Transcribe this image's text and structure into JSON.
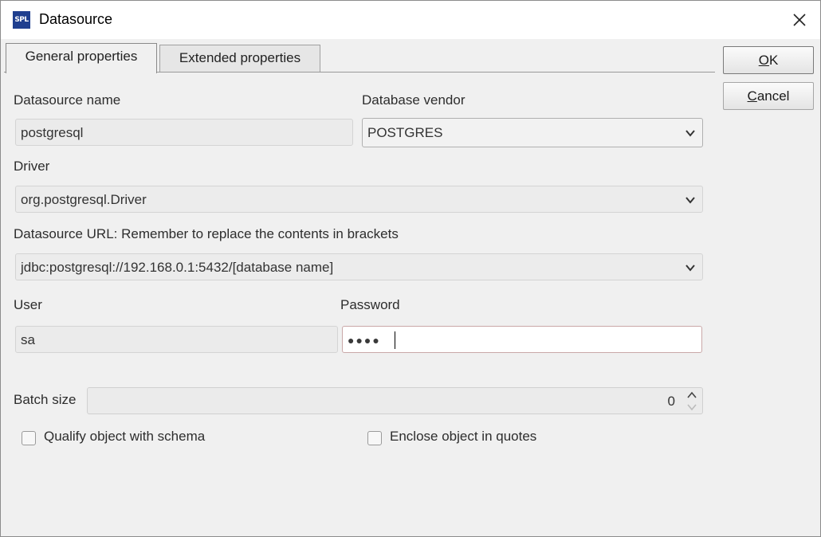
{
  "window": {
    "title": "Datasource",
    "app_icon_text": "SPL"
  },
  "tabs": [
    {
      "label": "General properties",
      "active": true
    },
    {
      "label": "Extended properties",
      "active": false
    }
  ],
  "buttons": {
    "ok": {
      "mnemonic": "O",
      "rest": "K"
    },
    "cancel": {
      "mnemonic": "C",
      "rest": "ancel"
    }
  },
  "form": {
    "datasource_name": {
      "label": "Datasource name",
      "value": "postgresql"
    },
    "database_vendor": {
      "label": "Database vendor",
      "value": "POSTGRES"
    },
    "driver": {
      "label": "Driver",
      "value": "org.postgresql.Driver"
    },
    "datasource_url": {
      "label": "Datasource URL: Remember to replace the contents in brackets",
      "value": "jdbc:postgresql://192.168.0.1:5432/[database name]"
    },
    "user": {
      "label": "User",
      "value": "sa"
    },
    "password": {
      "label": "Password",
      "masked_value": "●●●●"
    },
    "batch_size": {
      "label": "Batch size",
      "value": "0"
    },
    "qualify_schema": {
      "label": "Qualify object with schema",
      "checked": false
    },
    "enclose_quotes": {
      "label": "Enclose object in quotes",
      "checked": false
    }
  },
  "icons": {
    "app": "spl-app-icon",
    "close": "close-icon",
    "dropdown": "chevron-down-icon",
    "spin_up": "chevron-up-icon",
    "spin_down": "chevron-down-icon"
  },
  "colors": {
    "app_icon_bg": "#1f3f8f",
    "dialog_bg": "#f0f0f0",
    "titlebar_bg": "#ffffff"
  }
}
